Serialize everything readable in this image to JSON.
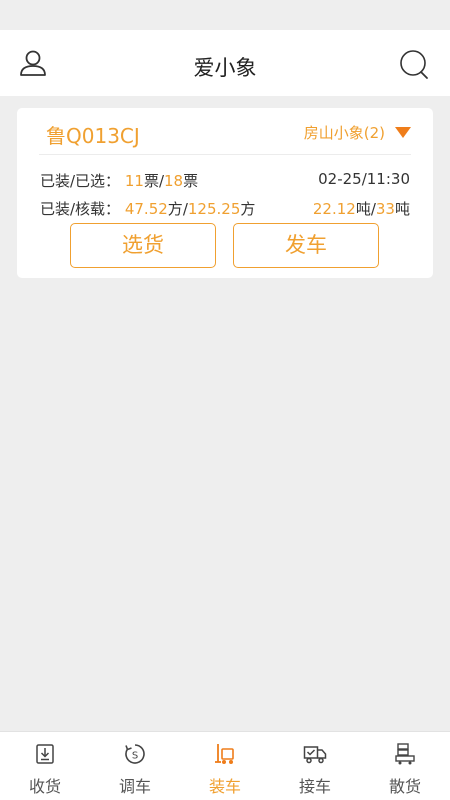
{
  "header": {
    "title": "爱小象"
  },
  "card": {
    "plate": "鲁Q013CJ",
    "route": "房山小象(2)",
    "row1": {
      "label": "已装/已选：",
      "loaded_tickets": "11",
      "ticket_unit_1": "票",
      "sep": "/",
      "selected_tickets": "18",
      "ticket_unit_2": "票",
      "datetime": "02-25/11:30"
    },
    "row2": {
      "label": "已装/核载：",
      "loaded_volume": "47.52",
      "volume_unit_1": "方",
      "sep": "/",
      "capacity_volume": "125.25",
      "volume_unit_2": "方",
      "loaded_weight": "22.12",
      "weight_unit_1": "吨",
      "sep2": "/",
      "capacity_weight": "33",
      "weight_unit_2": "吨"
    },
    "select_button": "选货",
    "depart_button": "发车"
  },
  "tabs": [
    {
      "label": "收货",
      "icon": "receive-icon",
      "active": false
    },
    {
      "label": "调车",
      "icon": "dispatch-icon",
      "active": false
    },
    {
      "label": "装车",
      "icon": "forklift-icon",
      "active": true
    },
    {
      "label": "接车",
      "icon": "truck-check-icon",
      "active": false
    },
    {
      "label": "散货",
      "icon": "warehouse-icon",
      "active": false
    }
  ],
  "colors": {
    "accent": "#f0a030",
    "arrow": "#ef7d1a",
    "background": "#eeeeee"
  }
}
